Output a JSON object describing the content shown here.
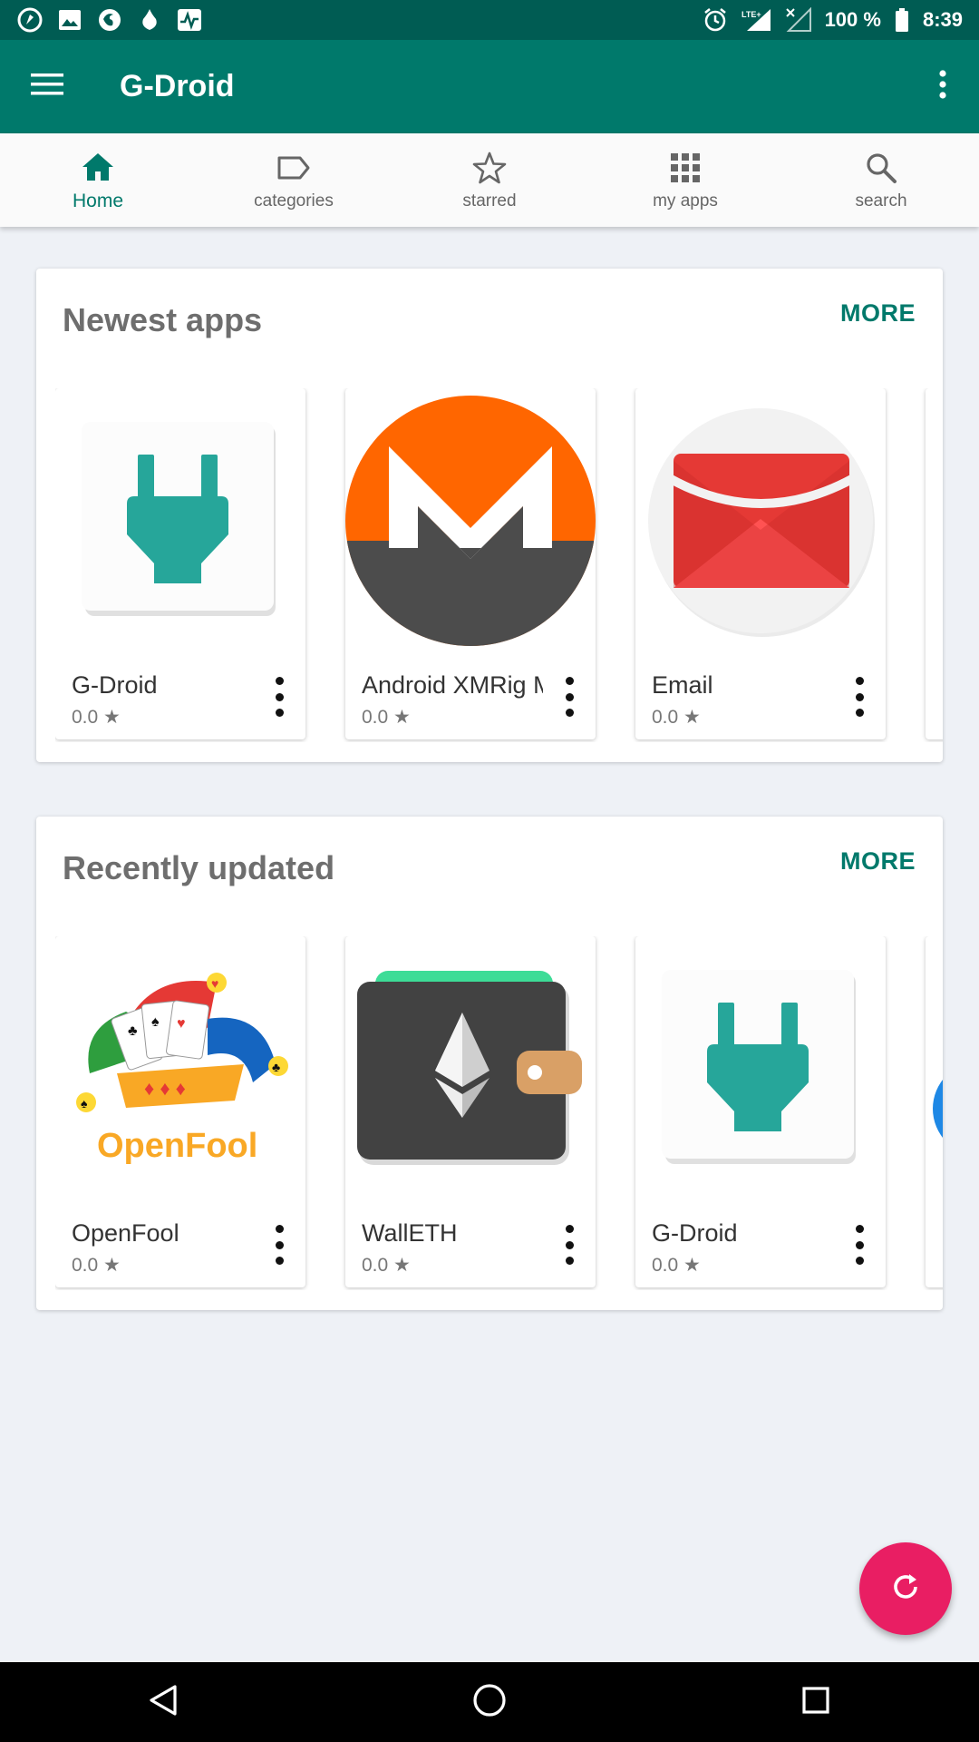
{
  "status_bar": {
    "battery": "100 %",
    "time": "8:39",
    "network": "LTE+",
    "left_icons": [
      "app-notification-icon",
      "image-icon",
      "firefox-icon",
      "drop-icon",
      "activity-icon"
    ]
  },
  "app_bar": {
    "title": "G-Droid"
  },
  "tabs": [
    {
      "label": "Home",
      "icon": "home-icon"
    },
    {
      "label": "categories",
      "icon": "label-icon"
    },
    {
      "label": "starred",
      "icon": "star-icon"
    },
    {
      "label": "my apps",
      "icon": "grid-icon"
    },
    {
      "label": "search",
      "icon": "search-icon"
    }
  ],
  "sections": [
    {
      "title": "Newest apps",
      "more_label": "MORE",
      "apps": [
        {
          "name": "G-Droid",
          "rating": "0.0 ★",
          "icon": "plug-icon"
        },
        {
          "name": "Android XMRig M...",
          "rating": "0.0 ★",
          "icon": "monero-icon"
        },
        {
          "name": "Email",
          "rating": "0.0 ★",
          "icon": "email-icon"
        }
      ]
    },
    {
      "title": "Recently updated",
      "more_label": "MORE",
      "apps": [
        {
          "name": "OpenFool",
          "rating": "0.0 ★",
          "icon": "openfool-icon",
          "icon_text": "OpenFool"
        },
        {
          "name": "WallETH",
          "rating": "0.0 ★",
          "icon": "wallet-icon"
        },
        {
          "name": "G-Droid",
          "rating": "0.0 ★",
          "icon": "plug-icon"
        }
      ]
    }
  ],
  "colors": {
    "primary": "#00796b",
    "status_bar": "#005c53",
    "accent": "#e91e63",
    "plug": "#26a69a",
    "monero_orange": "#ff6600",
    "monero_gray": "#4c4c4c",
    "email_red": "#e53935"
  },
  "fab": {
    "icon": "refresh-icon"
  }
}
